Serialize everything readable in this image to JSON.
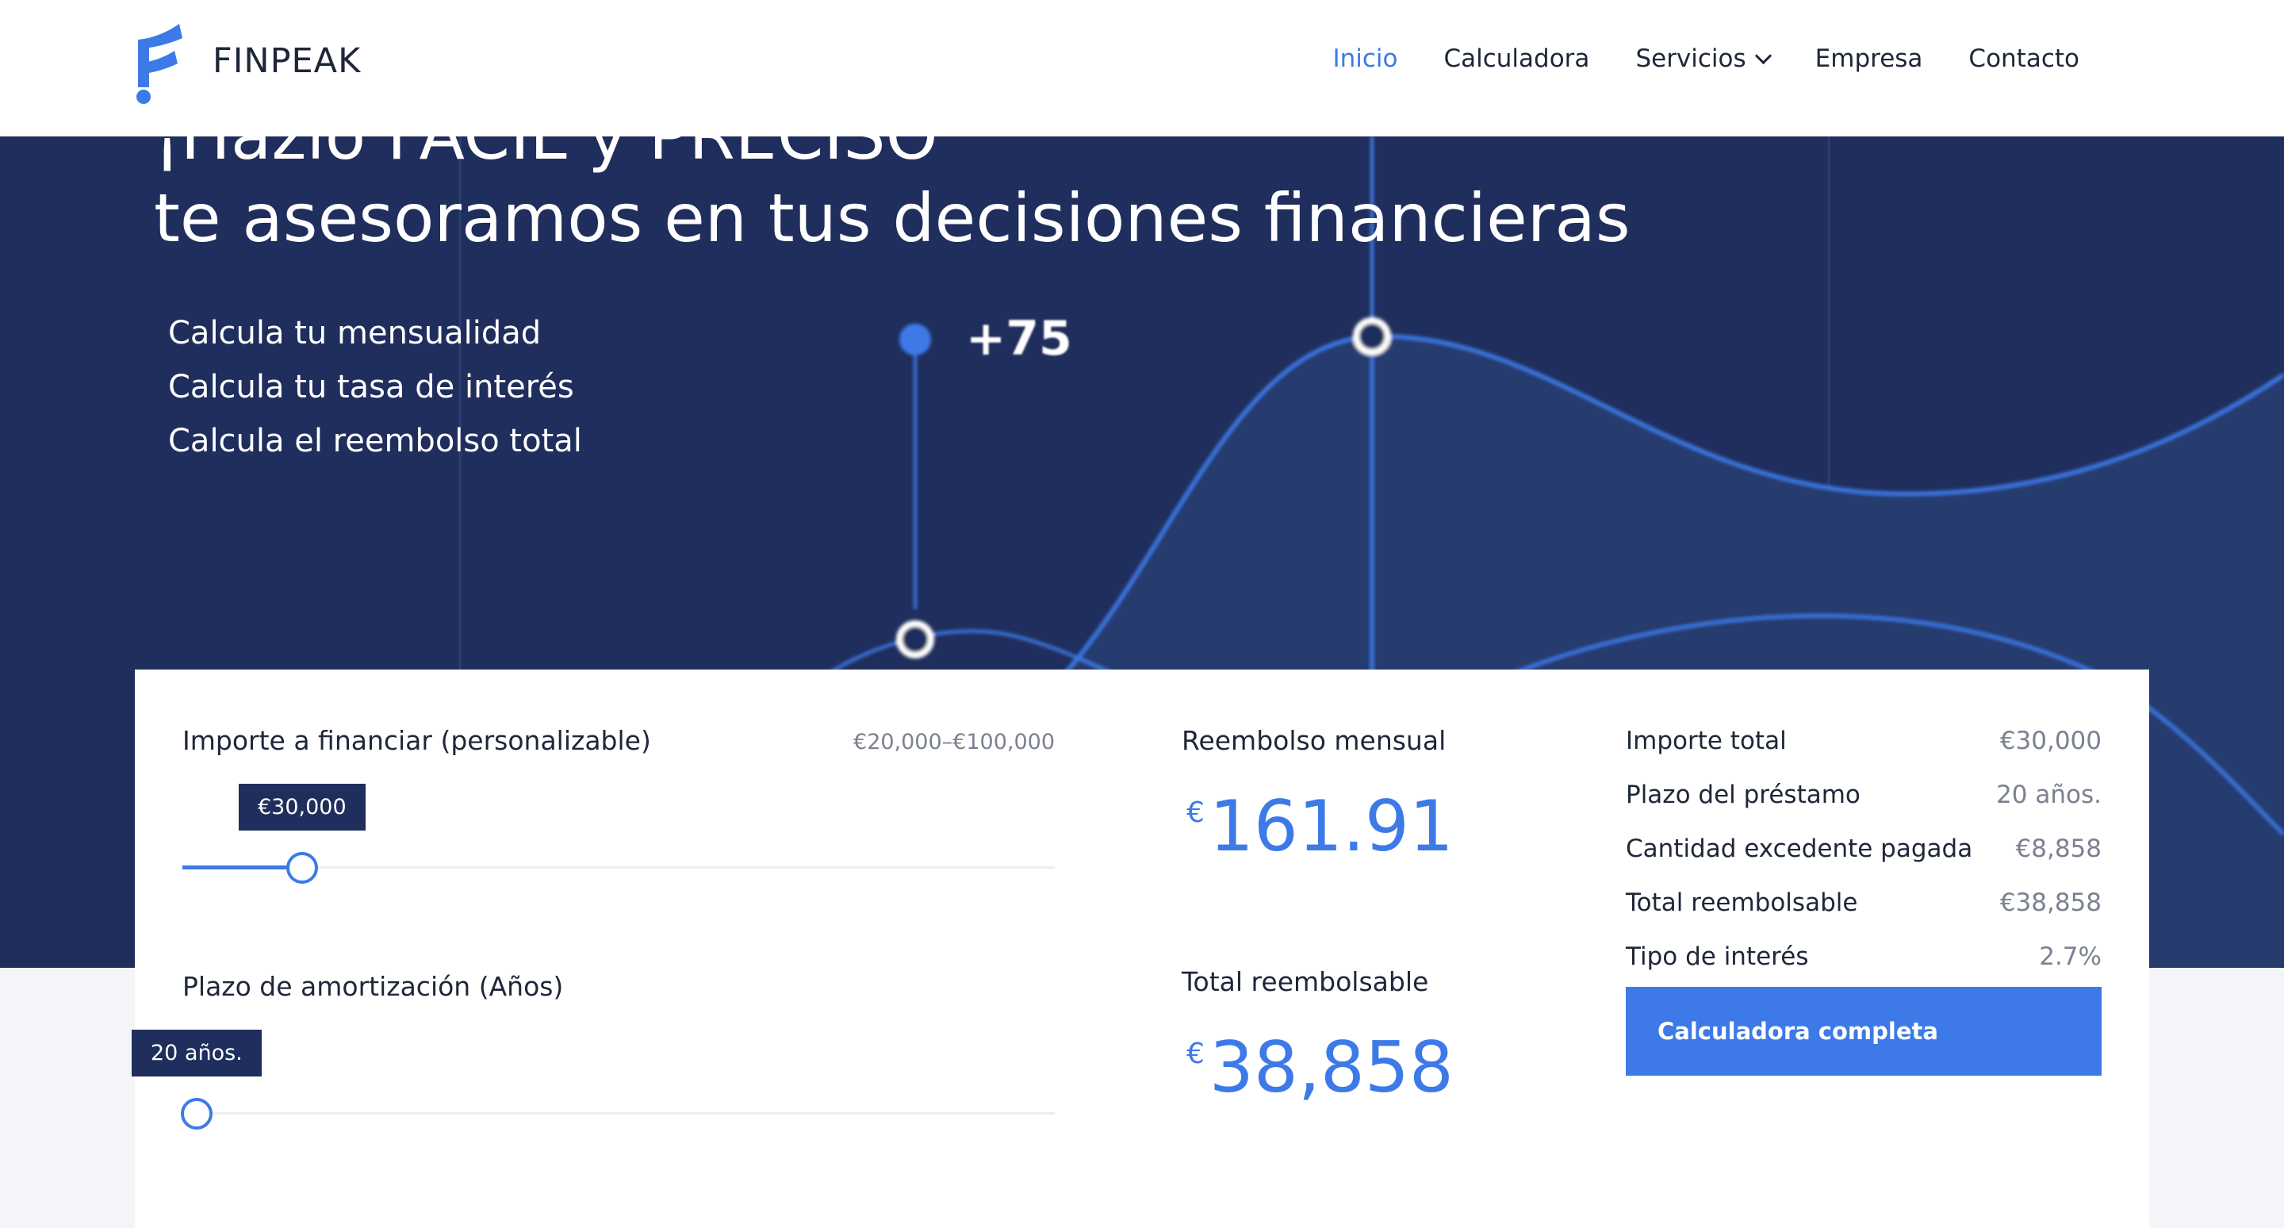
{
  "brand": {
    "name": "FINPEAK"
  },
  "nav": {
    "items": [
      {
        "label": "Inicio"
      },
      {
        "label": "Calculadora"
      },
      {
        "label": "Servicios"
      },
      {
        "label": "Empresa"
      },
      {
        "label": "Contacto"
      }
    ]
  },
  "hero": {
    "headline_1": "¡Hazlo FÁCIL y PRECISO",
    "headline_2": "te asesoramos en tus decisiones financieras",
    "features": [
      "Calcula tu mensualidad",
      "Calcula tu tasa de interés",
      "Calcula el reembolso total"
    ],
    "chart_label": "+75"
  },
  "calculator": {
    "amount": {
      "label": "Importe a financiar (personalizable)",
      "range": "€20,000–€100,000",
      "value": "€30,000",
      "fraction": 0.125
    },
    "term": {
      "label": "Plazo de amortización (Años)",
      "value": "20 años.",
      "fraction": 0
    },
    "monthly": {
      "label": "Reembolso mensual",
      "currency": "€",
      "value": "161.91"
    },
    "total": {
      "label": "Total reembolsable",
      "currency": "€",
      "value": "38,858"
    },
    "summary": [
      {
        "key": "Importe total",
        "value": "€30,000"
      },
      {
        "key": "Plazo del préstamo",
        "value": "20 años."
      },
      {
        "key": "Cantidad excedente pagada",
        "value": "€8,858"
      },
      {
        "key": "Total reembolsable",
        "value": "€38,858"
      },
      {
        "key": "Tipo de interés",
        "value": "2.7%"
      }
    ],
    "cta": "Calculadora completa"
  },
  "colors": {
    "accent": "#3d7ae8",
    "hero_bg": "#1f2e5c",
    "text": "#1e2738"
  }
}
